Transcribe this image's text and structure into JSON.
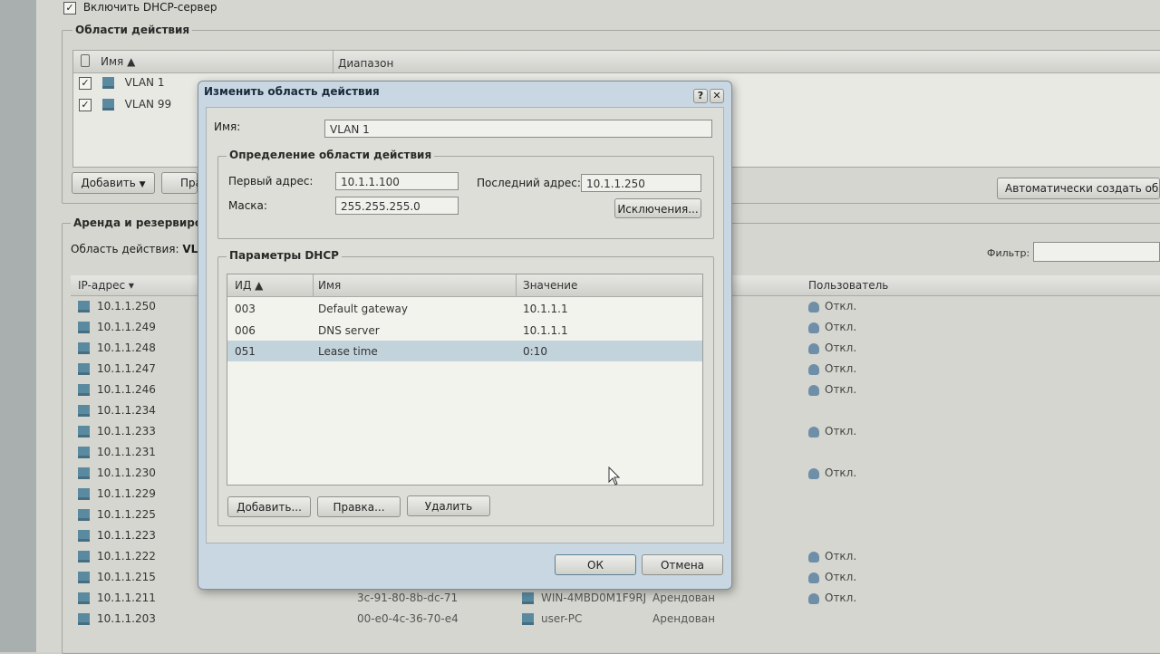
{
  "page": {
    "dhcp_enable_label": "Включить DHCP-сервер",
    "scopes_legend": "Области действия",
    "scopes_columns": {
      "name": "Имя ▲",
      "range": "Диапазон"
    },
    "scopes": [
      {
        "name": "VLAN 1"
      },
      {
        "name": "VLAN 99"
      }
    ],
    "add_button": "Добавить",
    "edit_button_partial": "Пра",
    "auto_create_button": "Автоматически создать области",
    "leases_legend": "Аренда и резервиров",
    "scope_label": "Область действия:",
    "scope_value": "VLAI",
    "filter_label": "Фильтр:",
    "leases_columns": {
      "ip": "IP-адрес ▾",
      "user": "Пользователь"
    },
    "leases": [
      {
        "ip": "10.1.1.250",
        "user": "Откл."
      },
      {
        "ip": "10.1.1.249",
        "user": "Откл."
      },
      {
        "ip": "10.1.1.248",
        "user": "Откл."
      },
      {
        "ip": "10.1.1.247",
        "user": "Откл."
      },
      {
        "ip": "10.1.1.246",
        "user": "Откл."
      },
      {
        "ip": "10.1.1.234",
        "user": ""
      },
      {
        "ip": "10.1.1.233",
        "user": "Откл."
      },
      {
        "ip": "10.1.1.231",
        "user": ""
      },
      {
        "ip": "10.1.1.230",
        "user": "Откл."
      },
      {
        "ip": "10.1.1.229",
        "user": ""
      },
      {
        "ip": "10.1.1.225",
        "user": ""
      },
      {
        "ip": "10.1.1.223",
        "user": ""
      },
      {
        "ip": "10.1.1.222",
        "user": "Откл."
      },
      {
        "ip": "10.1.1.215",
        "user": "Откл."
      },
      {
        "ip": "10.1.1.211",
        "mac": "3c-91-80-8b-dc-71",
        "host": "WIN-4MBD0M1F9RJ",
        "status": "Арендован",
        "user": "Откл."
      },
      {
        "ip": "10.1.1.203",
        "mac": "00-e0-4c-36-70-e4",
        "host": "user-PC",
        "status": "Арендован",
        "user": ""
      }
    ]
  },
  "dialog": {
    "title": "Изменить область действия",
    "help_label": "?",
    "close_label": "✕",
    "name_label": "Имя:",
    "name_value": "VLAN 1",
    "scope_def_legend": "Определение области действия",
    "first_addr_label": "Первый адрес:",
    "first_addr_value": "10.1.1.100",
    "last_addr_label": "Последний адрес:",
    "last_addr_value": "10.1.1.250",
    "mask_label": "Маска:",
    "mask_value": "255.255.255.0",
    "exclusions_button": "Исключения...",
    "dhcp_params_legend": "Параметры DHCP",
    "params_columns": {
      "id": "ИД ▲",
      "name": "Имя",
      "value": "Значение"
    },
    "params": [
      {
        "id": "003",
        "name": "Default gateway",
        "value": "10.1.1.1"
      },
      {
        "id": "006",
        "name": "DNS server",
        "value": "10.1.1.1"
      },
      {
        "id": "051",
        "name": "Lease time",
        "value": "0:10"
      }
    ],
    "add_button": "Добавить...",
    "edit_button": "Правка...",
    "delete_button": "Удалить",
    "ok_button": "ОК",
    "cancel_button": "Отмена"
  }
}
